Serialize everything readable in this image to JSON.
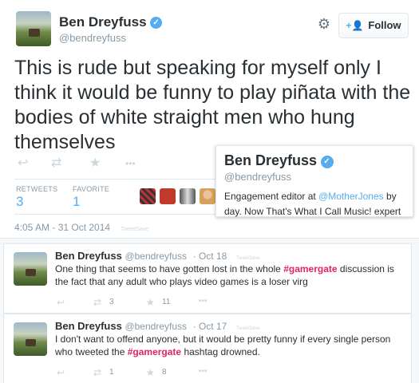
{
  "profile": {
    "name": "Ben Dreyfuss",
    "handle": "@bendreyfuss",
    "follow_label": "Follow",
    "follow_icon": "person-plus-icon",
    "settings_icon": "gear-icon"
  },
  "tweet": {
    "text": "This is rude but speaking for myself only I think it would be funny to play piñata with the bodies of white straight men who hung themselves",
    "actions": {
      "reply_icon": "↩",
      "retweet_icon": "⇄",
      "favorite_icon": "★",
      "more_icon": "•••"
    },
    "stats": {
      "retweets_label": "RETWEETS",
      "retweets_value": "3",
      "favorites_label": "FAVORITE",
      "favorites_value": "1"
    },
    "timestamp": "4:05 AM - 31 Oct 2014",
    "tweetsave": "TweetSave"
  },
  "hovercard": {
    "name": "Ben Dreyfuss",
    "handle": "@bendreyfuss",
    "bio_part1": "Engagement editor at ",
    "bio_mention": "@MotherJones",
    "bio_part2": " by day. Now That's What I Call Music! expert"
  },
  "feed": [
    {
      "name": "Ben Dreyfuss",
      "handle": "@bendreyfuss",
      "date": "· Oct 18",
      "tweetsave": "TweetSave",
      "text_before": "One thing that seems to have gotten lost in the whole ",
      "hashtag": "#gamergate",
      "text_after": " discussion is the fact that any adult who plays video games is a loser virg",
      "retweets": "3",
      "favorites": "11"
    },
    {
      "name": "Ben Dreyfuss",
      "handle": "@bendreyfuss",
      "date": "· Oct 17",
      "tweetsave": "TweetSave",
      "text_before": "I don't want to offend anyone, but it would be pretty funny if every single person who tweeted the ",
      "hashtag": "#gamergate",
      "text_after": " hashtag drowned.",
      "retweets": "1",
      "favorites": "8"
    }
  ],
  "colors": {
    "accent": "#55acee",
    "hashtag": "#e0245e",
    "muted": "#8899a6"
  }
}
